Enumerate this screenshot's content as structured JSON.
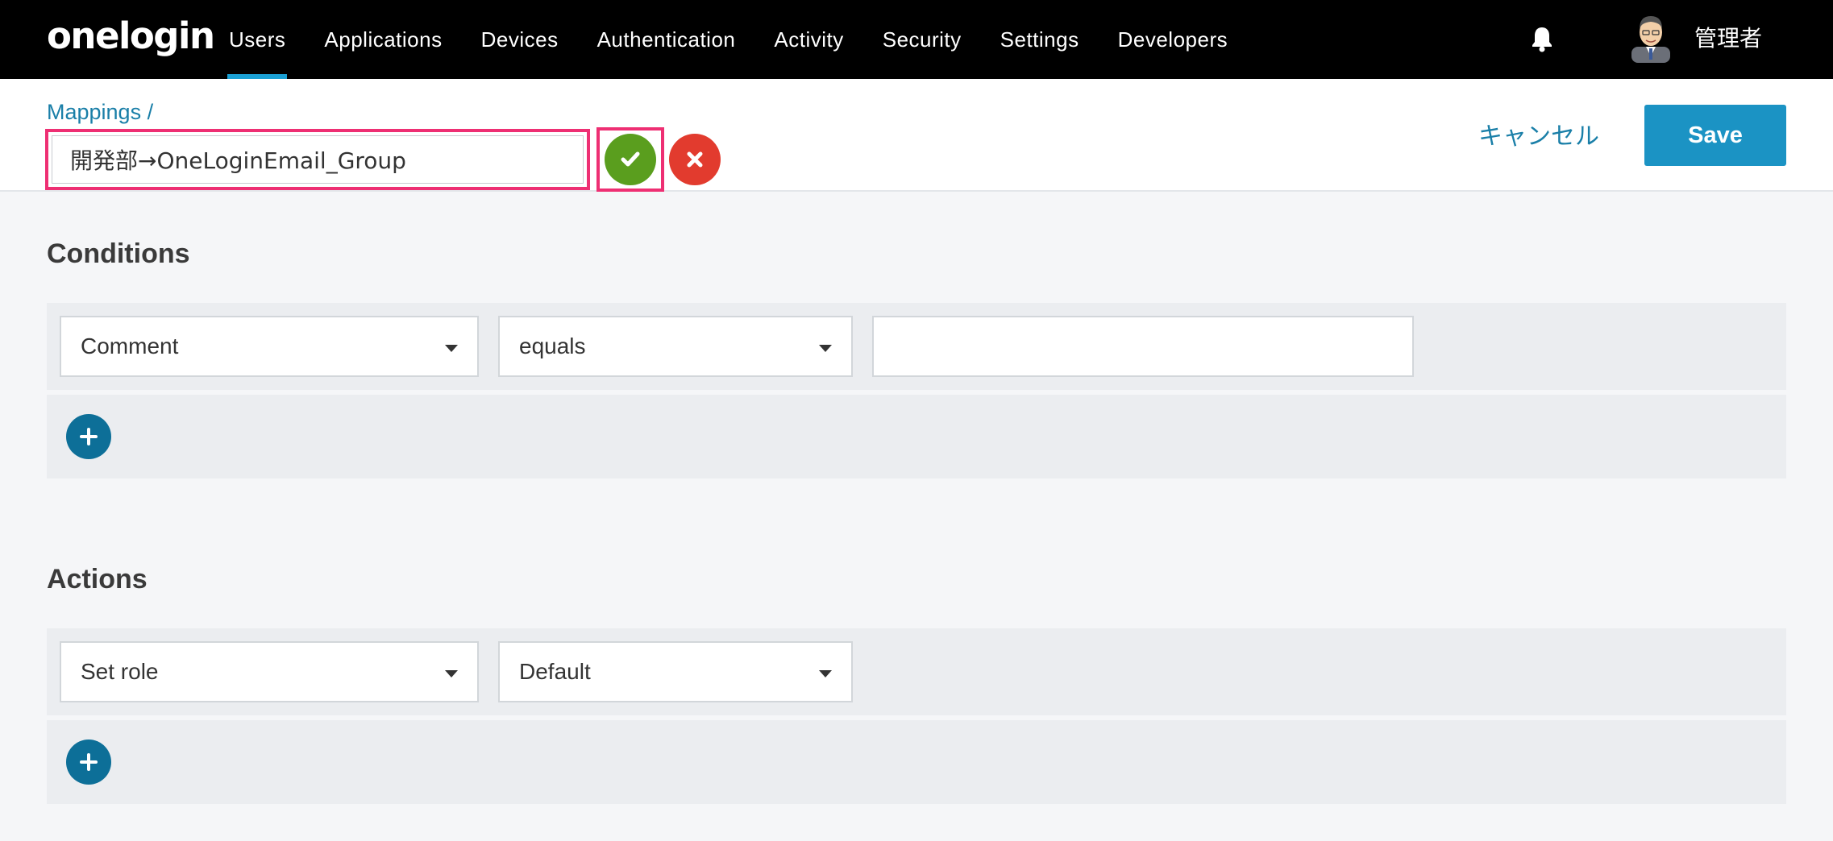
{
  "nav": {
    "logo": "onelogin",
    "links": [
      "Users",
      "Applications",
      "Devices",
      "Authentication",
      "Activity",
      "Security",
      "Settings",
      "Developers"
    ],
    "active": "Users",
    "username": "管理者",
    "accent_color": "#1aa0d4"
  },
  "header": {
    "breadcrumb": "Mappings /",
    "mapping_name": "開発部→OneLoginEmail_Group",
    "cancel_label": "キャンセル",
    "save_label": "Save"
  },
  "conditions": {
    "title": "Conditions",
    "rows": [
      {
        "field": "Comment",
        "operator": "equals",
        "value": ""
      }
    ]
  },
  "actions": {
    "title": "Actions",
    "rows": [
      {
        "action": "Set role",
        "value": "Default"
      }
    ]
  },
  "colors": {
    "highlight": "#ee2f73",
    "confirm": "#5a9e1e",
    "discard": "#e23b2e",
    "primary": "#1b93c4"
  }
}
